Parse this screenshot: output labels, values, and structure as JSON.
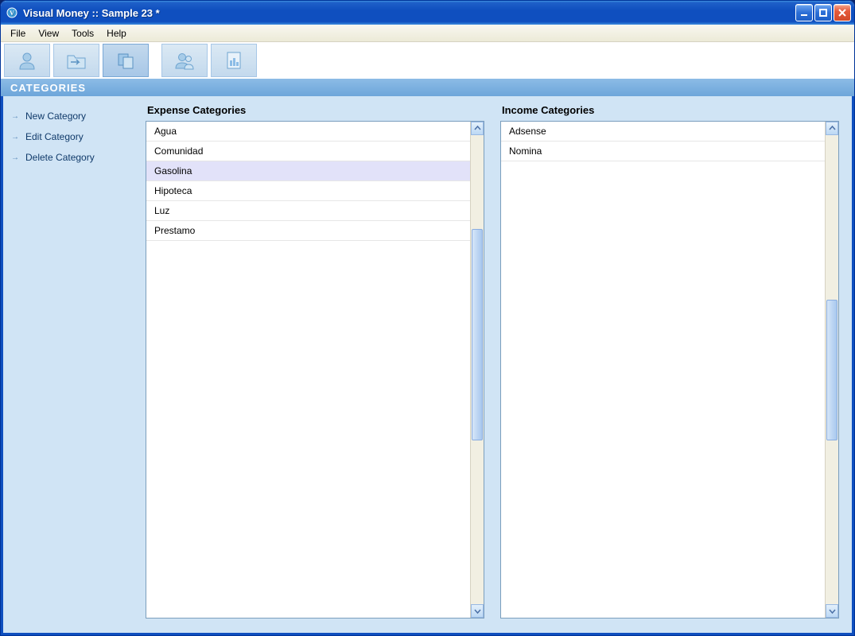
{
  "window": {
    "title": "Visual Money :: Sample 23 *"
  },
  "menubar": {
    "items": [
      "File",
      "View",
      "Tools",
      "Help"
    ]
  },
  "toolbar": {
    "buttons": [
      {
        "name": "accounts-tool",
        "icon": "user"
      },
      {
        "name": "transactions-tool",
        "icon": "folder-arrow"
      },
      {
        "name": "categories-tool",
        "icon": "stacks",
        "active": true
      },
      {
        "name": "payees-tool",
        "icon": "users"
      },
      {
        "name": "reports-tool",
        "icon": "doc-chart"
      }
    ]
  },
  "section": {
    "title": "CATEGORIES"
  },
  "sidebar": {
    "links": [
      {
        "label": "New Category"
      },
      {
        "label": "Edit Category"
      },
      {
        "label": "Delete Category"
      }
    ]
  },
  "panels": {
    "expense": {
      "title": "Expense Categories",
      "items": [
        "Agua",
        "Comunidad",
        "Gasolina",
        "Hipoteca",
        "Luz",
        "Prestamo"
      ],
      "selected_index": 2
    },
    "income": {
      "title": "Income Categories",
      "items": [
        "Adsense",
        "Nomina"
      ],
      "selected_index": -1
    }
  },
  "colors": {
    "titlebar_blue": "#0f4fbf",
    "section_blue": "#6da6da",
    "content_bg": "#d0e4f5",
    "selected_row": "#e2e2f9"
  }
}
